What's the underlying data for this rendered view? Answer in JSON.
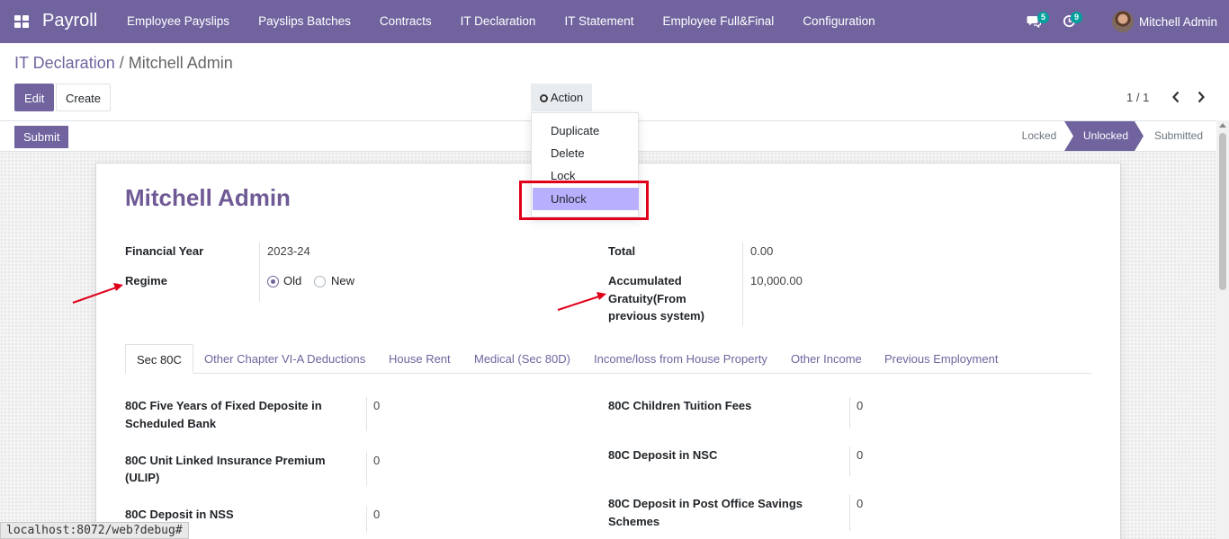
{
  "navbar": {
    "brand": "Payroll",
    "menu": [
      "Employee Payslips",
      "Payslips Batches",
      "Contracts",
      "IT Declaration",
      "IT Statement",
      "Employee Full&Final",
      "Configuration"
    ],
    "chat_count": "5",
    "activity_count": "9",
    "user_name": "Mitchell Admin",
    "accent_color": "#71639e"
  },
  "breadcrumb": {
    "parent": "IT Declaration",
    "separator": " / ",
    "current": "Mitchell Admin"
  },
  "toolbar": {
    "edit_label": "Edit",
    "create_label": "Create",
    "action_label": "Action",
    "pager": "1 / 1"
  },
  "action_menu": {
    "items": [
      "Duplicate",
      "Delete",
      "Lock",
      "Unlock"
    ],
    "highlighted": "Unlock"
  },
  "statusbar": {
    "submit_label": "Submit",
    "stages": [
      "Locked",
      "Unlocked",
      "Submitted"
    ],
    "active_stage": "Unlocked"
  },
  "record": {
    "title": "Mitchell Admin",
    "financial_year_label": "Financial Year",
    "financial_year": "2023-24",
    "regime_label": "Regime",
    "regime_options": [
      "Old",
      "New"
    ],
    "regime_selected": "Old",
    "total_label": "Total",
    "total": "0.00",
    "gratuity_label_line1": "Accumulated",
    "gratuity_label_line2": "Gratuity(From",
    "gratuity_label_line3": "previous system)",
    "gratuity": "10,000.00"
  },
  "tabs": [
    "Sec 80C",
    "Other Chapter VI-A Deductions",
    "House Rent",
    "Medical (Sec 80D)",
    "Income/loss from House Property",
    "Other Income",
    "Previous Employment"
  ],
  "sec80c": {
    "left": [
      {
        "label_line1": "80C Five Years of Fixed Deposite in",
        "label_line2": "Scheduled Bank",
        "value": "0"
      },
      {
        "label_line1": "80C Unit Linked Insurance Premium",
        "label_line2": "(ULIP)",
        "value": "0"
      },
      {
        "label_line1": "80C Deposit in NSS",
        "label_line2": "",
        "value": "0"
      }
    ],
    "right": [
      {
        "label_line1": "80C Children Tuition Fees",
        "label_line2": "",
        "value": "0"
      },
      {
        "label_line1": "80C Deposit in NSC",
        "label_line2": "",
        "value": "0"
      },
      {
        "label_line1": "80C Deposit in Post Office Savings",
        "label_line2": "Schemes",
        "value": "0"
      }
    ]
  },
  "status_url": "localhost:8072/web?debug#"
}
